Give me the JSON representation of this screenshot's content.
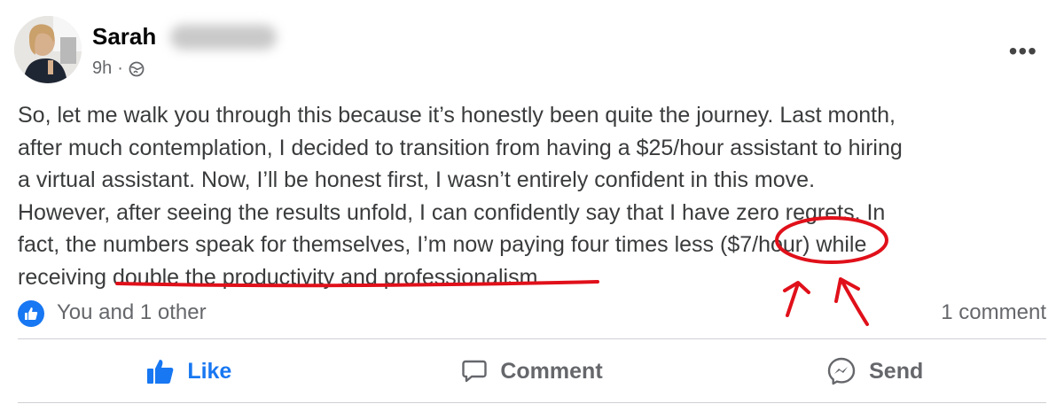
{
  "post": {
    "author": "Sarah",
    "timestamp": "9h",
    "separator": "·",
    "privacy_icon": "globe-icon",
    "more_options": "•••",
    "text_lines": [
      "So, let me walk you through this because it’s honestly been quite the journey. Last month,",
      "after much contemplation, I decided to transition from having a $25/hour assistant to hiring",
      "a virtual assistant. Now, I’ll be honest first, I wasn’t entirely confident in this move.",
      "However, after seeing the results unfold, I can confidently say that I have zero regrets. In",
      "fact, the numbers speak for themselves, I’m now paying four times less ($7/hour) while",
      "receiving double the productivity and professionalism."
    ]
  },
  "reactions": {
    "icon": "thumbs-up-icon",
    "text": "You and 1 other",
    "comments": "1 comment"
  },
  "actions": {
    "like": "Like",
    "comment": "Comment",
    "send": "Send"
  },
  "colors": {
    "accent": "#1877f2",
    "annotation": "#e0101a",
    "muted": "#65676b"
  }
}
